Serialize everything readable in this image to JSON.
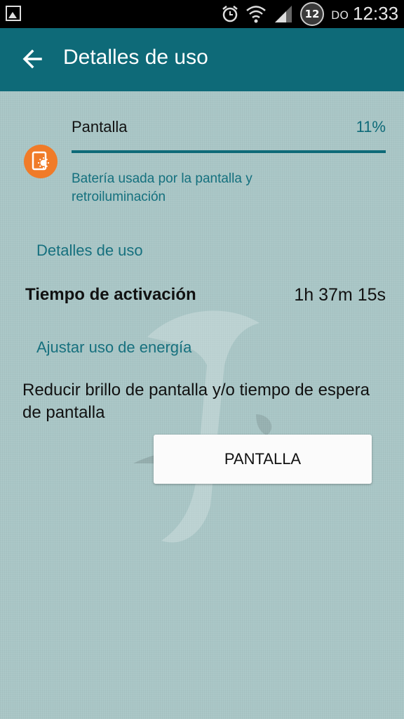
{
  "status_bar": {
    "time": "12:33",
    "day": "DO",
    "notification_count": "12",
    "icons": [
      "gallery-icon",
      "alarm-icon",
      "wifi-icon",
      "signal-icon"
    ]
  },
  "app_bar": {
    "title": "Detalles de uso",
    "back_icon": "arrow-back-icon"
  },
  "usage_item": {
    "title": "Pantalla",
    "percent_label": "11%",
    "percent": 11,
    "description": "Batería usada por la pantalla y retroiluminación",
    "icon": "screen-brightness-icon"
  },
  "details": {
    "header": "Detalles de uso",
    "rows": [
      {
        "label": "Tiempo de activación",
        "value": "1h 37m 15s"
      }
    ]
  },
  "adjust": {
    "header": "Ajustar uso de energía",
    "tip": "Reducir brillo de pantalla y/o tiempo de espera de pantalla",
    "button_label": "PANTALLA"
  },
  "colors": {
    "accent": "#0e6a78",
    "icon_orange": "#f07b28",
    "background": "#a9c6c6"
  }
}
